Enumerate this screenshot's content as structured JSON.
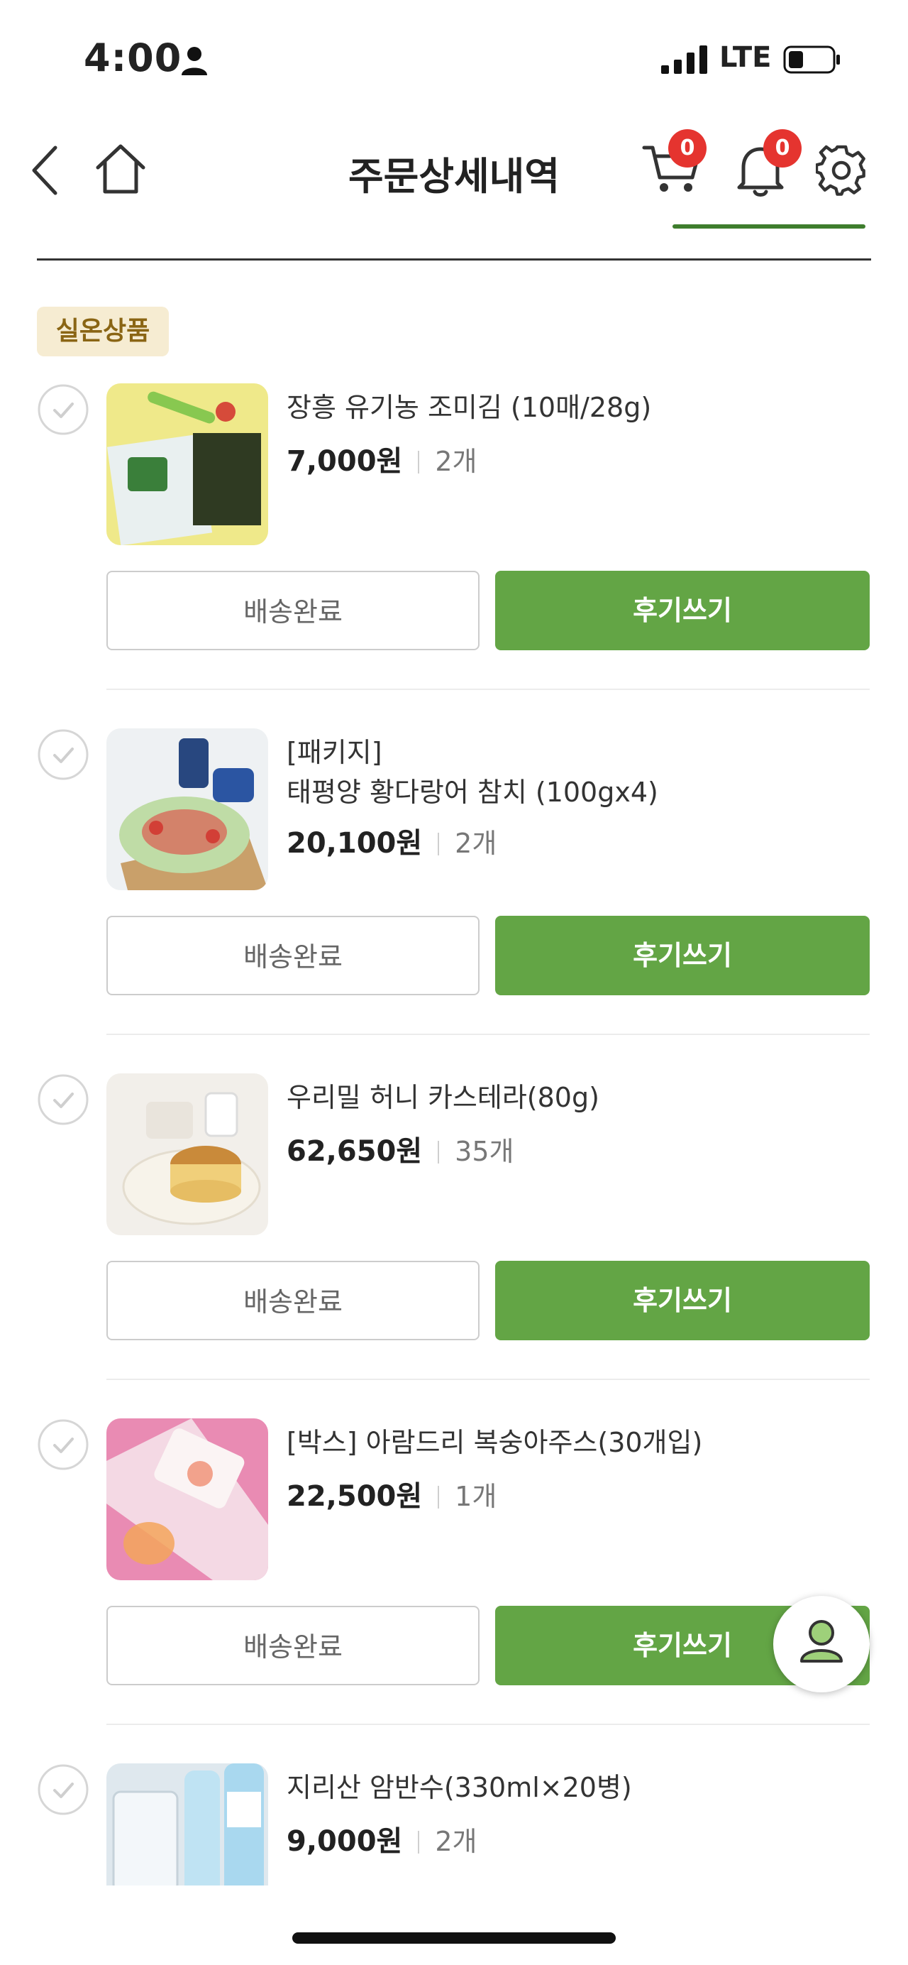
{
  "status_bar": {
    "time": "4:00",
    "network": "LTE"
  },
  "header": {
    "title": "주문상세내역",
    "cart_count": "0",
    "notification_count": "0"
  },
  "section": {
    "label": "실온상품"
  },
  "items": [
    {
      "name_lines": [
        "장흥 유기농 조미김 (10매/28g)"
      ],
      "price": "7,000",
      "unit": "원",
      "quantity": "2개",
      "status": "배송완료",
      "review": "후기쓰기"
    },
    {
      "name_lines": [
        "[패키지]",
        "태평양 황다랑어 참치 (100gx4)"
      ],
      "price": "20,100",
      "unit": "원",
      "quantity": "2개",
      "status": "배송완료",
      "review": "후기쓰기"
    },
    {
      "name_lines": [
        "우리밀 허니 카스테라(80g)"
      ],
      "price": "62,650",
      "unit": "원",
      "quantity": "35개",
      "status": "배송완료",
      "review": "후기쓰기"
    },
    {
      "name_lines": [
        "[박스] 아람드리 복숭아주스(30개입)"
      ],
      "price": "22,500",
      "unit": "원",
      "quantity": "1개",
      "status": "배송완료",
      "review": "후기쓰기"
    },
    {
      "name_lines": [
        "지리산 암반수(330ml×20병)"
      ],
      "price": "9,000",
      "unit": "원",
      "quantity": "2개"
    }
  ],
  "colors": {
    "accent_green": "#63a545",
    "badge_red": "#e5342f",
    "label_bg": "#f6ecd2",
    "label_text": "#8a6514"
  }
}
